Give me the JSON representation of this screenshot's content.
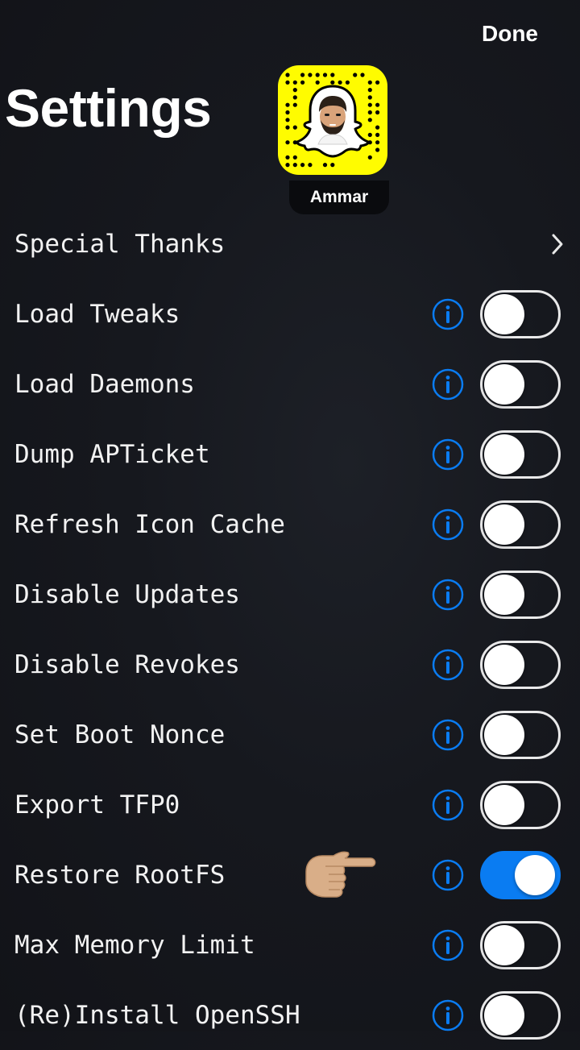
{
  "header": {
    "done_label": "Done",
    "title": "Settings"
  },
  "profile": {
    "username": "Ammar",
    "snapcode_color": "#fffc00"
  },
  "settings": [
    {
      "label": "Special Thanks",
      "type": "link",
      "icon": "chevron-right-icon"
    },
    {
      "label": "Load Tweaks",
      "type": "toggle",
      "on": false
    },
    {
      "label": "Load Daemons",
      "type": "toggle",
      "on": false
    },
    {
      "label": "Dump APTicket",
      "type": "toggle",
      "on": false
    },
    {
      "label": "Refresh Icon Cache",
      "type": "toggle",
      "on": false
    },
    {
      "label": "Disable Updates",
      "type": "toggle",
      "on": false
    },
    {
      "label": "Disable Revokes",
      "type": "toggle",
      "on": false
    },
    {
      "label": "Set Boot Nonce",
      "type": "toggle",
      "on": false
    },
    {
      "label": "Export TFP0",
      "type": "toggle",
      "on": false
    },
    {
      "label": "Restore RootFS",
      "type": "toggle",
      "on": true,
      "annotation": "pointing-hand-emoji"
    },
    {
      "label": "Max Memory Limit",
      "type": "toggle",
      "on": false
    },
    {
      "label": "(Re)Install OpenSSH",
      "type": "toggle",
      "on": false
    }
  ],
  "colors": {
    "accent": "#0a7cf2",
    "background": "#16181e"
  }
}
